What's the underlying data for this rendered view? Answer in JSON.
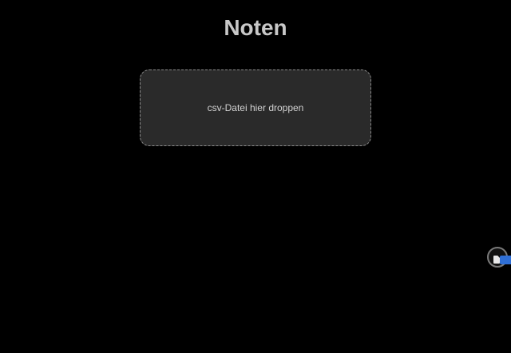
{
  "page": {
    "title": "Noten"
  },
  "dropzone": {
    "label": "csv-Datei hier droppen"
  },
  "drag": {
    "icon": "file-icon",
    "badge_color": "#2f6fd6"
  },
  "colors": {
    "background": "#000000",
    "title": "#c8c8c8",
    "dropzone_fill": "#262626",
    "dropzone_border": "#8a8a8a",
    "dropzone_text": "#d2d2d2"
  }
}
